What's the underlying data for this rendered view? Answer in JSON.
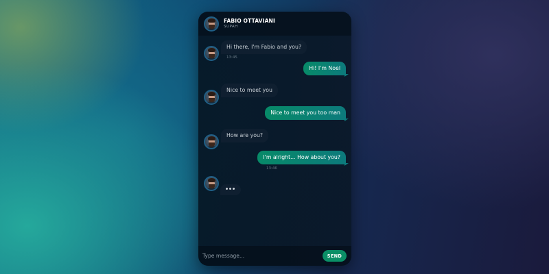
{
  "header": {
    "contact_name": "FABIO OTTAVIANI",
    "contact_status": "SUPAH"
  },
  "messages": [
    {
      "from": "contact",
      "text": "Hi there, I'm Fabio and you?",
      "time": "13:45"
    },
    {
      "from": "me",
      "text": "Hi! I'm Noel"
    },
    {
      "from": "contact",
      "text": "Nice to meet you"
    },
    {
      "from": "me",
      "text": "Nice to meet you too man"
    },
    {
      "from": "contact",
      "text": "How are you?"
    },
    {
      "from": "me",
      "text": "I'm alright... How about you?",
      "time": "13:46"
    },
    {
      "from": "contact",
      "typing": true
    }
  ],
  "composer": {
    "placeholder": "Type message...",
    "send_label": "SEND"
  },
  "colors": {
    "accent": "#0a8f66",
    "outgoing_bubble": "#078a68",
    "incoming_bubble": "#102030"
  }
}
